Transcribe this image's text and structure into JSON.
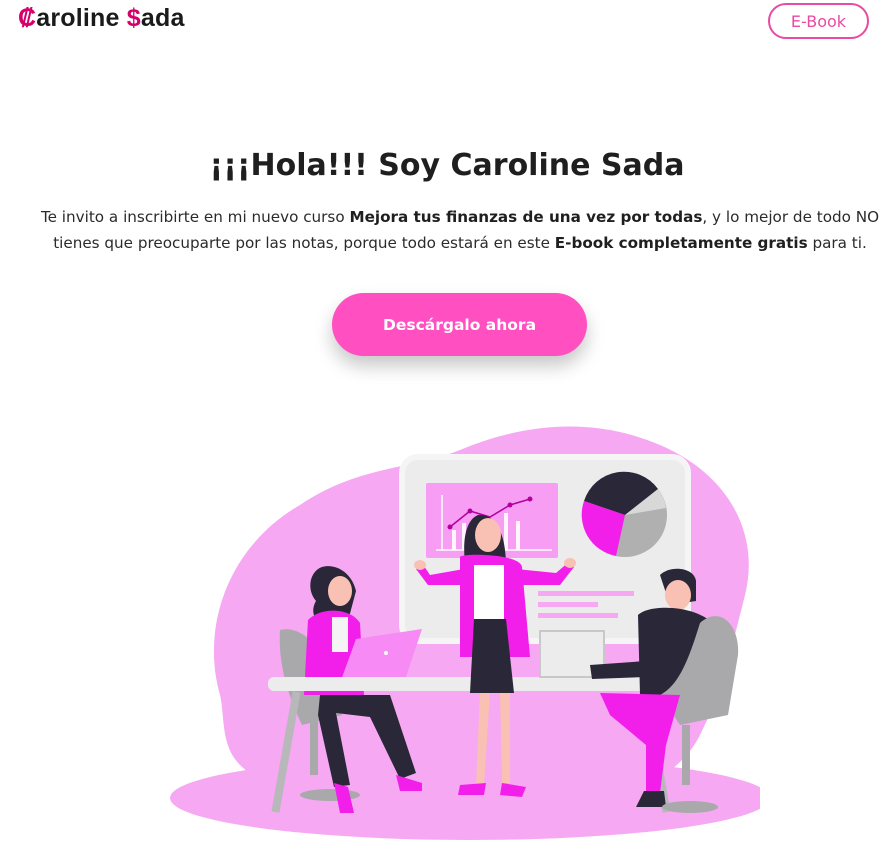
{
  "header": {
    "logo_first_letter": "₡",
    "logo_part1": "aroline ",
    "logo_s": "$",
    "logo_part2": "ada",
    "ebook_label": "E-Book"
  },
  "hero": {
    "title": "¡¡¡Hola!!! Soy Caroline Sada",
    "text_1": "Te invito a inscribirte en mi nuevo curso ",
    "course_name": "Mejora tus finanzas de una vez por todas",
    "text_2": ", y lo mejor de todo NO tienes que preocuparte por las notas, porque todo estará en este ",
    "ebook_free": "E-book completamente gratis",
    "text_3": " para ti.",
    "cta_label": "Descárgalo ahora"
  },
  "colors": {
    "brand_pink": "#ff4fc1",
    "logo_accent": "#d6006d",
    "outline_pink": "#e94aa2",
    "blob": "#f6a8f2",
    "magenta": "#f21fea"
  },
  "illustration": {
    "icon": "team-meeting-illustration"
  }
}
